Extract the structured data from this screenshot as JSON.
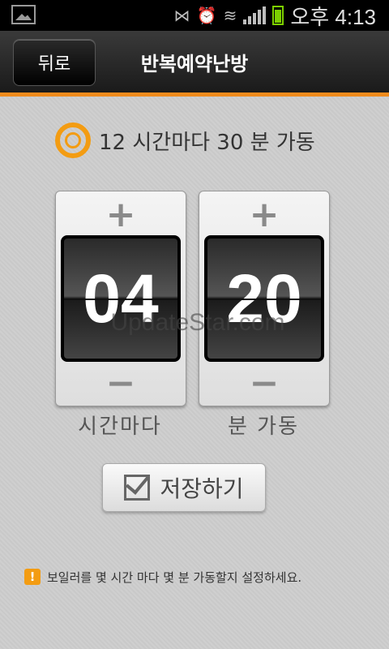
{
  "status_bar": {
    "time": "오후 4:13",
    "icons": [
      "gallery-icon",
      "mute-icon",
      "alarm-icon",
      "wifi-icon",
      "signal-icon",
      "battery-icon"
    ],
    "battery_color": "#7ccf00"
  },
  "title_bar": {
    "back_label": "뒤로",
    "title": "반복예약난방",
    "accent_color": "#f08b1c"
  },
  "summary": {
    "text": "12 시간마다 30 분 가동"
  },
  "hours_picker": {
    "plus_label": "+",
    "value": "04",
    "minus_label": "−",
    "caption": "시간마다"
  },
  "minutes_picker": {
    "plus_label": "+",
    "value": "20",
    "minus_label": "−",
    "caption": "분  가동"
  },
  "watermark": "UpdateStar.com",
  "save_button": {
    "label": "저장하기"
  },
  "notice": {
    "icon": "!",
    "text": "보일러를 몇 시간 마다 몇 분 가동할지 설정하세요."
  }
}
